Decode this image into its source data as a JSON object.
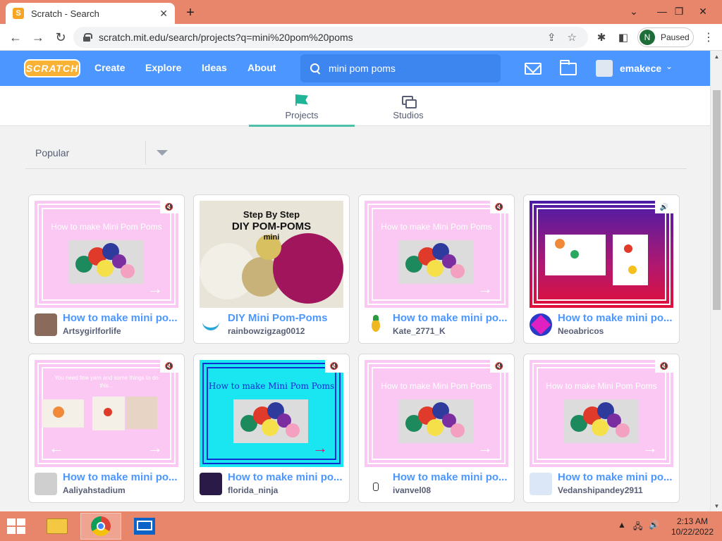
{
  "browser": {
    "tab_title": "Scratch - Search",
    "tab_favicon": "S",
    "url": "scratch.mit.edu/search/projects?q=mini%20pom%20poms",
    "profile_initial": "N",
    "profile_status": "Paused"
  },
  "scratch": {
    "logo": "SCRATCH",
    "nav": [
      "Create",
      "Explore",
      "Ideas",
      "About"
    ],
    "search_query": "mini pom poms",
    "username": "emakece",
    "tabs": [
      "Projects",
      "Studios"
    ],
    "active_tab": "Projects",
    "sort": "Popular",
    "accent": "#4c97ff",
    "tab_accent": "#4ec0a8"
  },
  "projects": [
    {
      "title": "How to make mini po...",
      "user": "Artsygirlforlife"
    },
    {
      "title": "DIY Mini Pom-Poms",
      "user": "rainbowzigzag0012",
      "thumb_title_1": "Step By Step",
      "thumb_title_2": "DIY POM-POMS",
      "thumb_title_3": "mini"
    },
    {
      "title": "How to make mini po...",
      "user": "Kate_2771_K"
    },
    {
      "title": "How to make mini po...",
      "user": "Neoabricos"
    },
    {
      "title": "How to make mini po...",
      "user": "Aaliyahstadium"
    },
    {
      "title": "How to make mini po...",
      "user": "florida_ninja"
    },
    {
      "title": "How to make mini po...",
      "user": "ivanvel08"
    },
    {
      "title": "How to make mini po...",
      "user": "Vedanshipandey2911"
    }
  ],
  "taskbar": {
    "time": "2:13 AM",
    "date": "10/22/2022"
  }
}
